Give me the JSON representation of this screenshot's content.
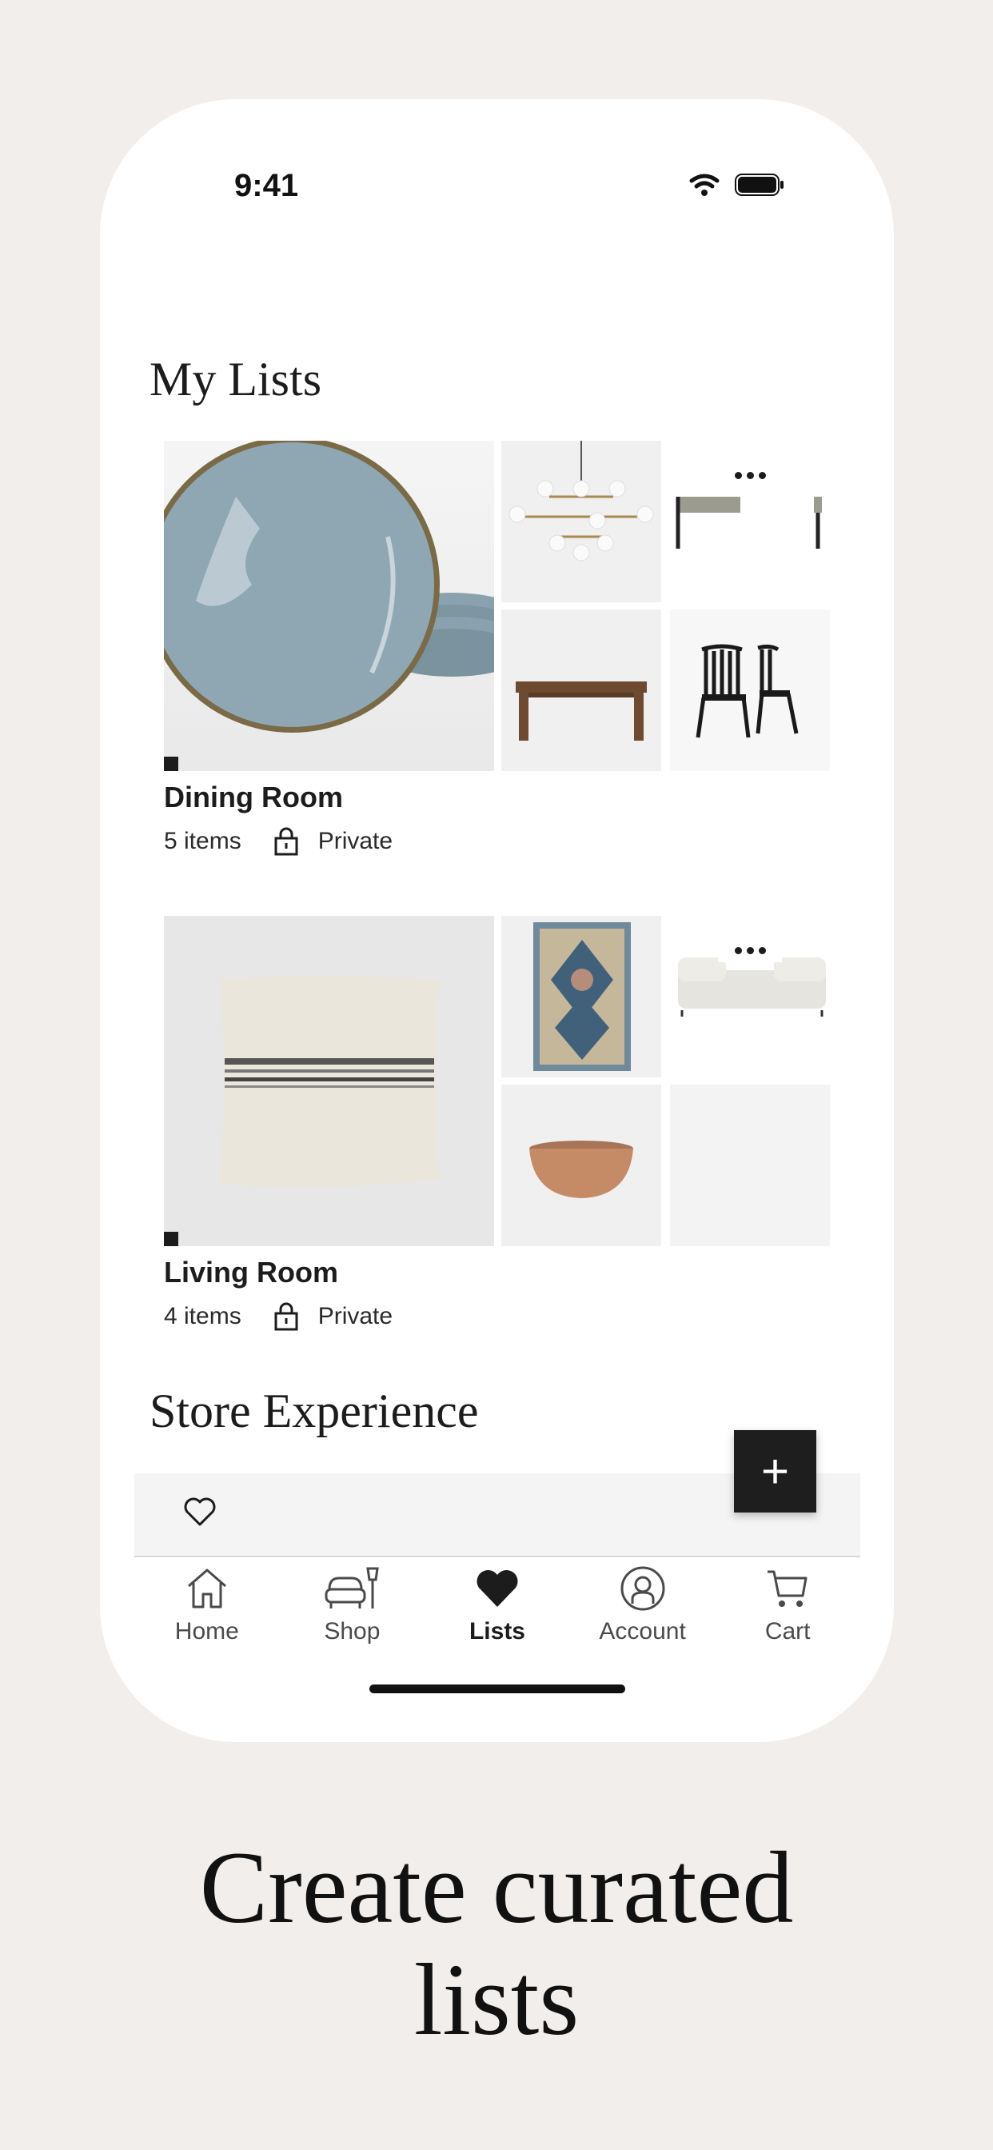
{
  "status": {
    "time": "9:41"
  },
  "sections": {
    "my_lists": "My Lists",
    "store_experience": "Store Experience"
  },
  "lists": [
    {
      "name": "Dining Room",
      "count": "5 items",
      "privacy": "Private"
    },
    {
      "name": "Living Room",
      "count": "4 items",
      "privacy": "Private"
    }
  ],
  "fab": {
    "label": "+"
  },
  "tabs": [
    {
      "label": "Home",
      "icon": "home-icon"
    },
    {
      "label": "Shop",
      "icon": "shop-icon"
    },
    {
      "label": "Lists",
      "icon": "heart-filled-icon",
      "active": true
    },
    {
      "label": "Account",
      "icon": "account-icon"
    },
    {
      "label": "Cart",
      "icon": "cart-icon"
    }
  ],
  "headline": {
    "line1": "Create curated",
    "line2": "lists"
  },
  "colors": {
    "background": "#f1eeeb",
    "phone": "#ffffff",
    "accent": "#1e1e1e"
  }
}
